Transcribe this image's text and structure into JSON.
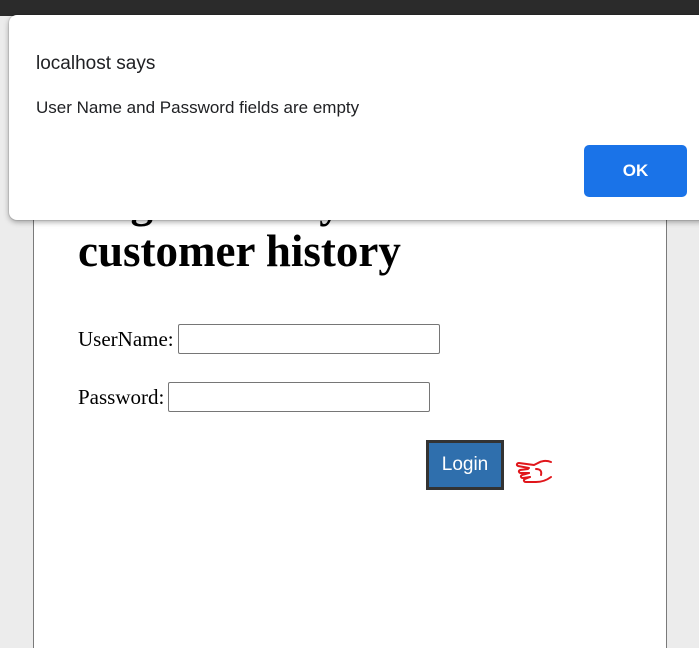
{
  "page": {
    "heading": "Login to see your customer history",
    "username_label": "UserName:",
    "username_value": "",
    "password_label": "Password:",
    "password_value": "",
    "login_label": "Login"
  },
  "alert": {
    "origin": "localhost says",
    "message": "User Name and Password fields are empty",
    "ok_label": "OK"
  },
  "icons": {
    "pointer": "hand-pointer-icon"
  },
  "colors": {
    "login_button_bg": "#2f6fad",
    "ok_button_bg": "#1a73e8",
    "pointer_icon": "#e0161b"
  }
}
